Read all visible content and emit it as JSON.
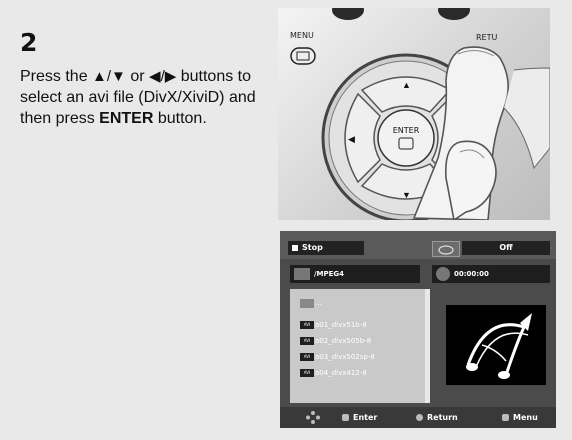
{
  "step": "2",
  "instructions": {
    "part1": "Press the ",
    "part2": " or ",
    "part3": " buttons to select an avi file (DivX/XiviD) and then press ",
    "enter": "ENTER",
    "part4": " button."
  },
  "remote": {
    "menu_label": "MENU",
    "return_label": "RETU",
    "enter_label": "ENTER"
  },
  "screen": {
    "status": "Stop",
    "repeat": "Off",
    "folder": "/MPEG4",
    "time": "00:00:00",
    "parent_entry": "...",
    "avi_tag": "AVI",
    "files": [
      "a01_divx51b-8",
      "a02_divx505b-8",
      "a03_divx502sp-8",
      "a04_divx412-8"
    ],
    "bottom": {
      "enter": "Enter",
      "return": "Return",
      "menu": "Menu"
    }
  }
}
